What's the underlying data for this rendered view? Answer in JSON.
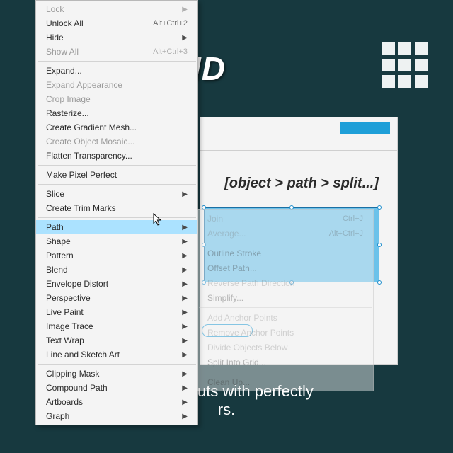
{
  "bg_title": "GRID",
  "canvas": {
    "subtitle": "[object > path > split...]"
  },
  "caption_line1": "ting layouts with perfectly",
  "caption_line2": "rs.",
  "menu": {
    "items": [
      {
        "label": "Lock",
        "submenu": true,
        "disabled": true
      },
      {
        "label": "Unlock All",
        "shortcut": "Alt+Ctrl+2"
      },
      {
        "label": "Hide",
        "submenu": true
      },
      {
        "label": "Show All",
        "shortcut": "Alt+Ctrl+3",
        "disabled": true
      },
      {
        "sep": true
      },
      {
        "label": "Expand..."
      },
      {
        "label": "Expand Appearance",
        "disabled": true
      },
      {
        "label": "Crop Image",
        "disabled": true
      },
      {
        "label": "Rasterize..."
      },
      {
        "label": "Create Gradient Mesh..."
      },
      {
        "label": "Create Object Mosaic...",
        "disabled": true
      },
      {
        "label": "Flatten Transparency..."
      },
      {
        "sep": true
      },
      {
        "label": "Make Pixel Perfect"
      },
      {
        "sep": true
      },
      {
        "label": "Slice",
        "submenu": true
      },
      {
        "label": "Create Trim Marks"
      },
      {
        "sep": true
      },
      {
        "label": "Path",
        "submenu": true,
        "highlight": true
      },
      {
        "label": "Shape",
        "submenu": true
      },
      {
        "label": "Pattern",
        "submenu": true
      },
      {
        "label": "Blend",
        "submenu": true
      },
      {
        "label": "Envelope Distort",
        "submenu": true
      },
      {
        "label": "Perspective",
        "submenu": true
      },
      {
        "label": "Live Paint",
        "submenu": true
      },
      {
        "label": "Image Trace",
        "submenu": true
      },
      {
        "label": "Text Wrap",
        "submenu": true
      },
      {
        "label": "Line and Sketch Art",
        "submenu": true
      },
      {
        "sep": true
      },
      {
        "label": "Clipping Mask",
        "submenu": true
      },
      {
        "label": "Compound Path",
        "submenu": true
      },
      {
        "label": "Artboards",
        "submenu": true
      },
      {
        "label": "Graph",
        "submenu": true
      }
    ]
  },
  "submenu": {
    "items": [
      {
        "label": "Join",
        "shortcut": "Ctrl+J",
        "disabled": true
      },
      {
        "label": "Average...",
        "shortcut": "Alt+Ctrl+J",
        "disabled": true
      },
      {
        "sep": true
      },
      {
        "label": "Outline Stroke"
      },
      {
        "label": "Offset Path..."
      },
      {
        "label": "Reverse Path Direction",
        "disabled": true
      },
      {
        "label": "Simplify..."
      },
      {
        "sep": true
      },
      {
        "label": "Add Anchor Points",
        "disabled": true
      },
      {
        "label": "Remove Anchor Points",
        "disabled": true
      },
      {
        "label": "Divide Objects Below",
        "disabled": true
      },
      {
        "label": "Split Into Grid..."
      },
      {
        "sep": true
      },
      {
        "label": "Clean Up..."
      }
    ]
  }
}
